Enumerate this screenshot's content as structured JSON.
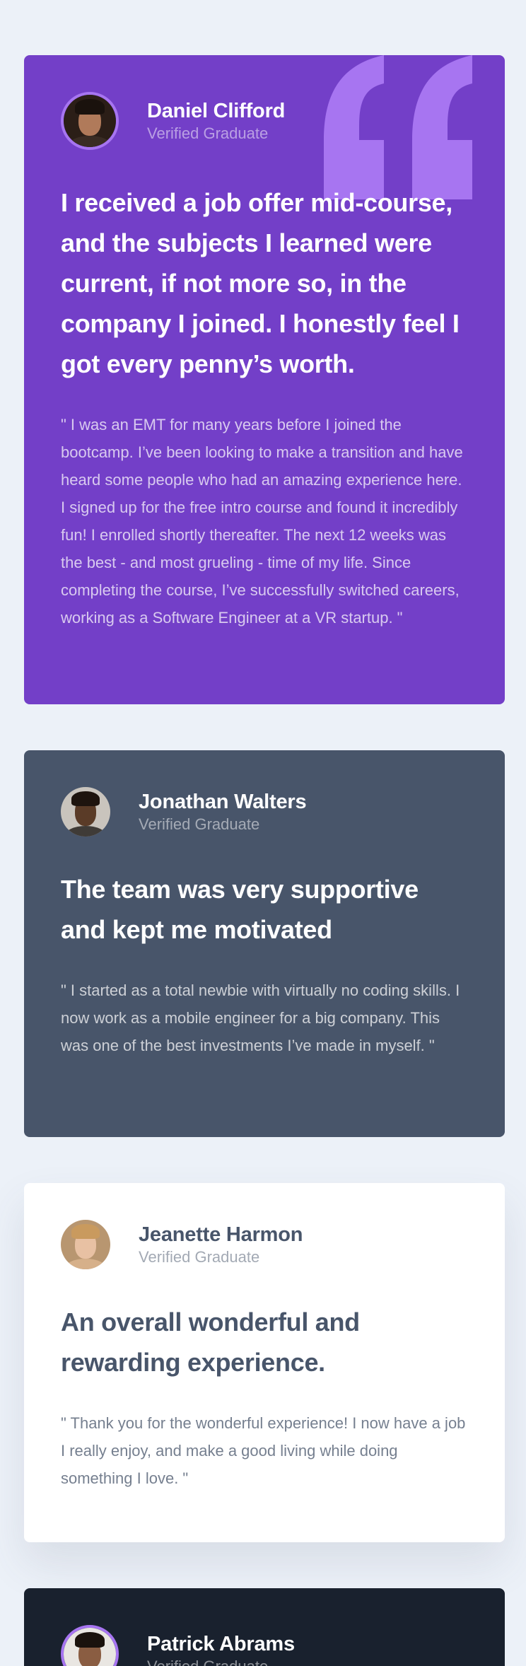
{
  "testimonials": [
    {
      "name": "Daniel Clifford",
      "role": "Verified Graduate",
      "headline": "I received a job offer mid-course, and the subjects I learned were current, if not more so, in the company I joined. I honestly feel I got every penny’s worth.",
      "body": "\" I was an EMT for many years before I joined the bootcamp. I’ve been looking to make a transition and have heard some people who had an amazing experience here. I signed up for the free intro course and found it incredibly fun! I enrolled shortly thereafter. The next 12 weeks was the best - and most grueling - time of my life. Since completing the course, I’ve successfully switched careers, working as a Software Engineer at a VR startup. \"",
      "card_color": "#733FC8"
    },
    {
      "name": "Jonathan Walters",
      "role": "Verified Graduate",
      "headline": "The team was very supportive and kept me motivated",
      "body": "\" I started as a total newbie with virtually no coding skills. I now work as a mobile engineer for a big company. This was one of the best investments I’ve made in myself. \"",
      "card_color": "#48556A"
    },
    {
      "name": "Jeanette Harmon",
      "role": "Verified Graduate",
      "headline": "An overall wonderful and rewarding experience.",
      "body": "\" Thank you for the wonderful experience! I now have a job I really enjoy, and make a good living while doing something I love. \"",
      "card_color": "#FFFFFF"
    },
    {
      "name": "Patrick Abrams",
      "role": "Verified Graduate",
      "card_color": "#19212E"
    }
  ],
  "colors": {
    "page_background": "#ECF1F8",
    "accent_ring": "#A775F1",
    "quote_mark": "#A775F1"
  },
  "icons": {
    "quote": "quotation-mark-icon"
  }
}
